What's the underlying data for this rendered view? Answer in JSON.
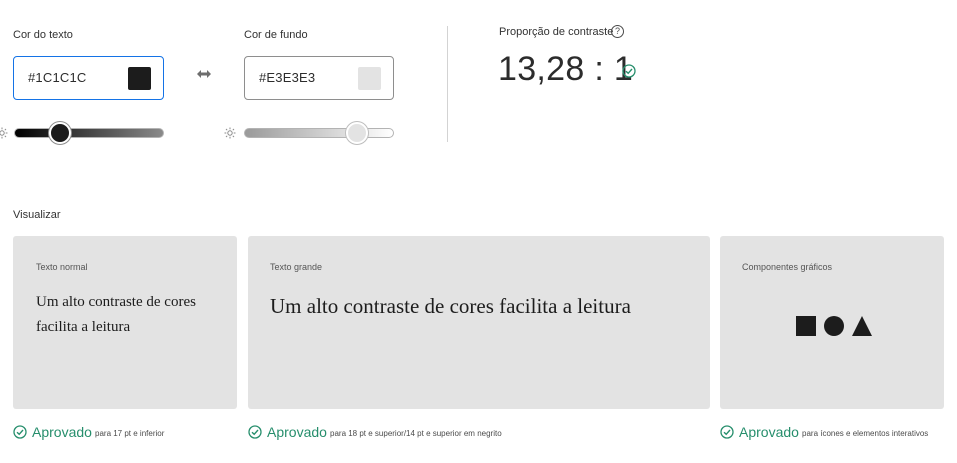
{
  "text_color": {
    "label": "Cor do texto",
    "hex": "#1C1C1C",
    "swatch_color": "#1c1c1c"
  },
  "background_color": {
    "label": "Cor de fundo",
    "hex": "#E3E3E3",
    "swatch_color": "#e3e3e3"
  },
  "contrast": {
    "label": "Proporção de contraste",
    "help_glyph": "?",
    "value": "13,28 : 1"
  },
  "preview": {
    "title": "Visualizar",
    "cards": [
      {
        "label": "Texto normal",
        "sample": "Um alto contraste de cores facilita a leitura"
      },
      {
        "label": "Texto grande",
        "sample": "Um alto contraste de cores facilita a leitura"
      },
      {
        "label": "Componentes gráficos",
        "shapes": [
          "square-icon",
          "circle-icon",
          "triangle-icon"
        ]
      }
    ],
    "results": [
      {
        "status": "Aprovado",
        "note": "para 17 pt e inferior"
      },
      {
        "status": "Aprovado",
        "note": "para 18 pt e superior/14 pt e superior em negrito"
      },
      {
        "status": "Aprovado",
        "note": "para ícones e elementos interativos"
      }
    ]
  },
  "colors": {
    "accent_blue": "#1473e6",
    "pass_green": "#268e6c",
    "card_bg": "#e3e3e3",
    "text": "#1c1c1c"
  }
}
